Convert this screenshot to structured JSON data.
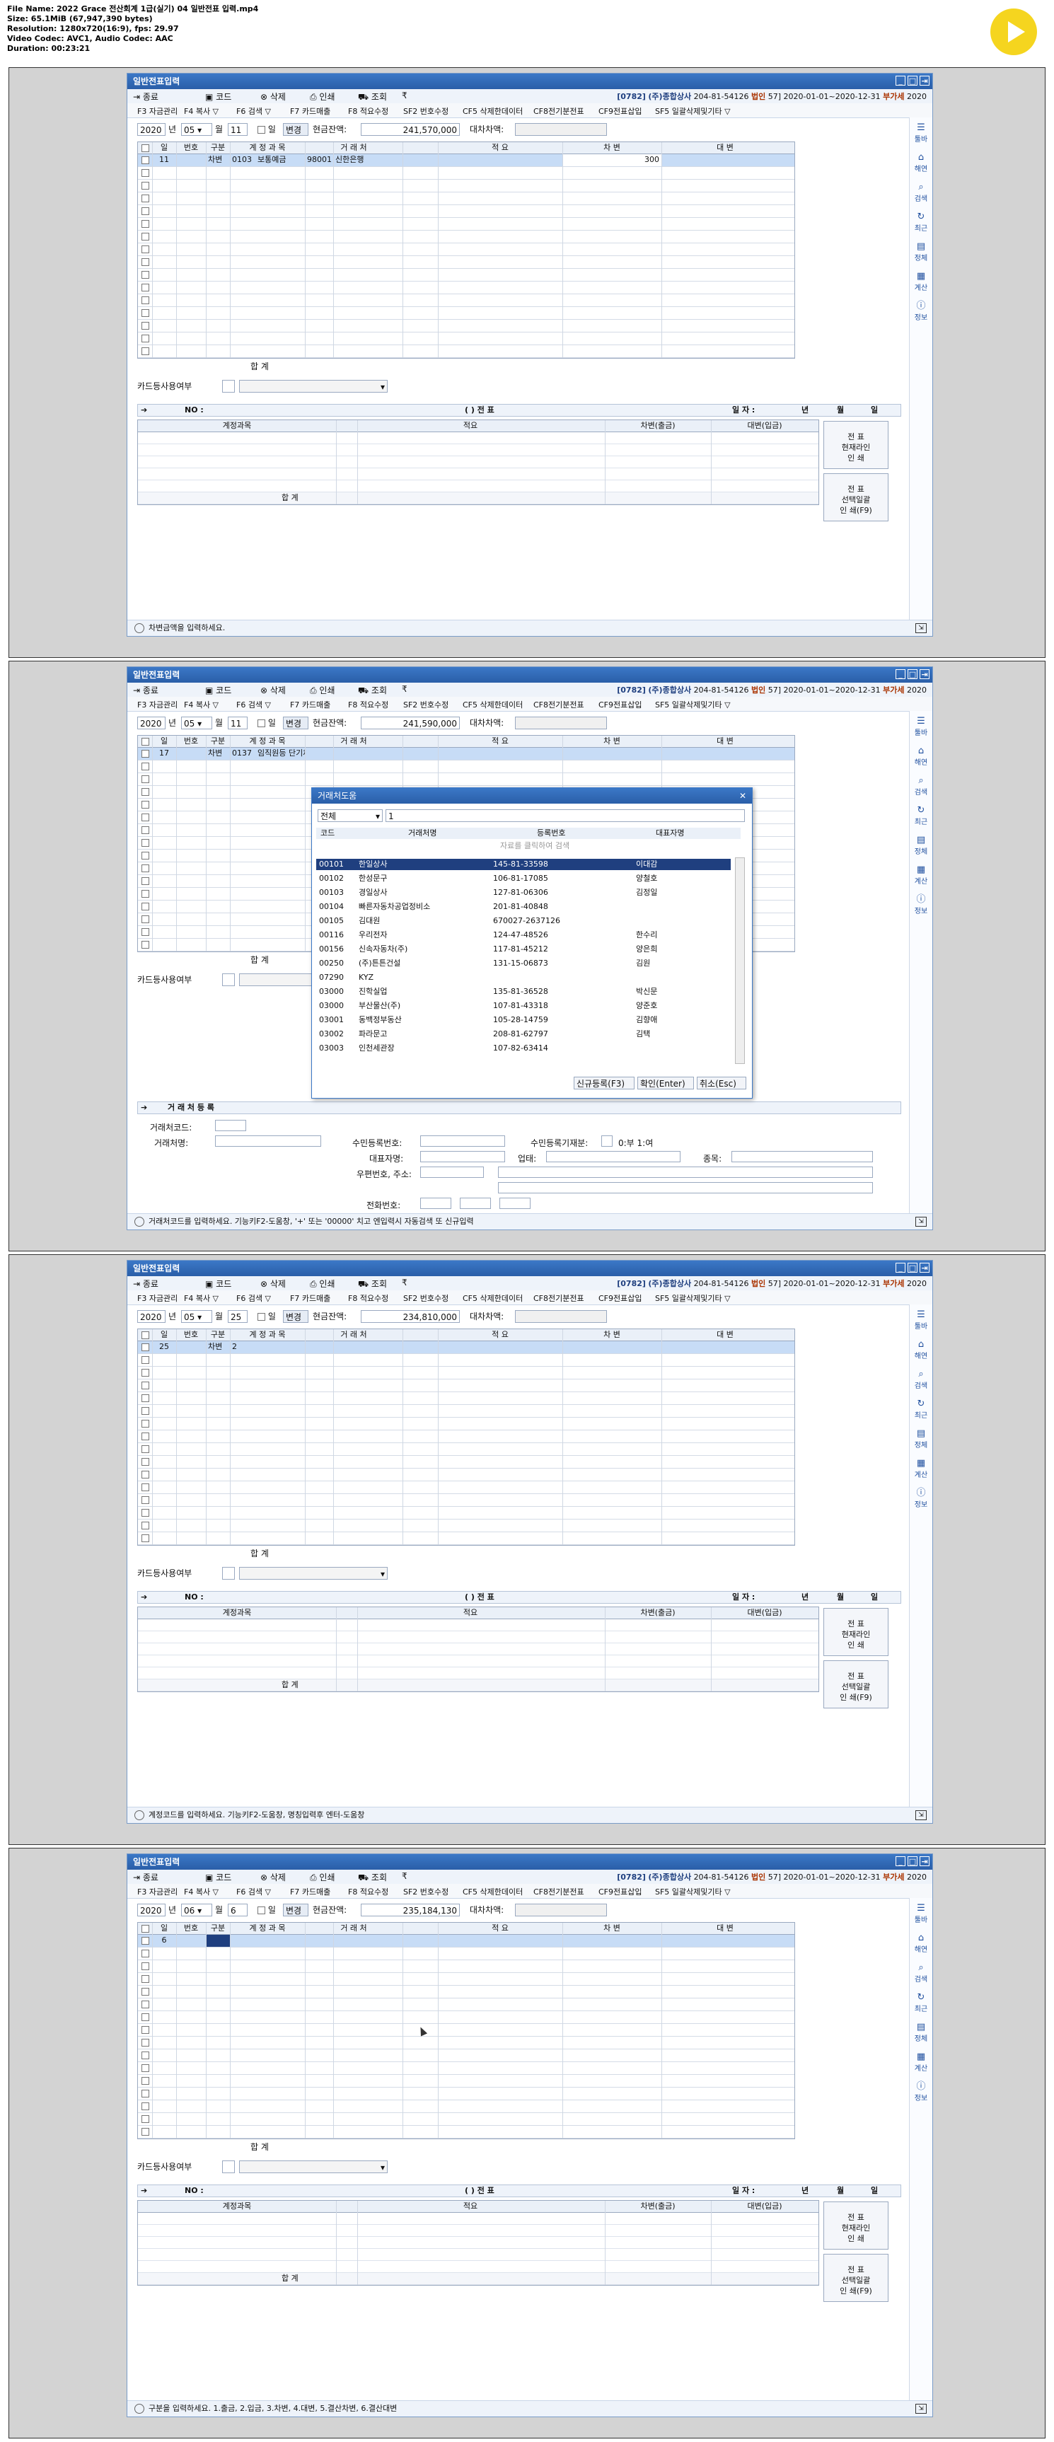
{
  "file_info": {
    "file_name": "File Name: 2022 Grace 전산회계 1급(실기) 04 일반전표 입력.mp4",
    "size": "Size: 65.1MiB (67,947,390 bytes)",
    "resolution": "Resolution: 1280x720(16:9), fps: 29.97",
    "video_codec": "Video Codec: AVC1, Audio Codec: AAC",
    "duration": "Duration: 00:23:21"
  },
  "window": {
    "title": "일반전표입력",
    "toolbar": {
      "close": "종료",
      "code": "코드",
      "delete": "삭제",
      "print": "인쇄",
      "view": "조회",
      "more": "₹"
    },
    "company_code": "[0782]",
    "company_name": "(주)종합상사",
    "biz_no": "204-81-54126",
    "entity": "법인",
    "period_no": "57]",
    "period": "2020-01-01~2020-12-31",
    "vat_label": "부가세",
    "vat_year": "2020",
    "fkeys": [
      "F3 자금관리",
      "F4 복사 ▽",
      "F6 검색 ▽",
      "F7 카드매출",
      "F8 적요수정",
      "SF2 번호수정",
      "CF5 삭제한데이터",
      "CF8전기분전표",
      "CF9전표삽입",
      "SF5 일괄삭제및기타 ▽"
    ],
    "sidebar": [
      "툴바",
      "해연",
      "검색",
      "최근",
      "정체",
      "계산",
      "정보"
    ],
    "labels": {
      "year": "년",
      "month": "월",
      "day": "일",
      "change": "변경",
      "cash_balance": "현금잔액:",
      "debit_credit_diff": "대차차액:",
      "total": "합      계",
      "card_usage": "카드등사용여부",
      "no": "NO :",
      "jeonpyo": "(          ) 전   표",
      "date": "일 자 :",
      "y": "년",
      "m": "월",
      "d": "일"
    },
    "grid_headers": {
      "day": "일",
      "no": "번호",
      "type": "구분",
      "account": "계 정 과 목",
      "client": "거 래 처",
      "memo": "적 요",
      "debit": "차 변",
      "credit": "대 변"
    },
    "journal_headers": {
      "account": "계정과목",
      "memo": "적요",
      "debit": "차변(출금)",
      "credit": "대변(입금)",
      "total": "합          계"
    },
    "journal_buttons": {
      "b1": [
        "전",
        "표",
        "현재라인",
        "인",
        "쇄"
      ],
      "b2": [
        "전",
        "표",
        "선택일괄",
        "인",
        "쇄(F9)"
      ]
    }
  },
  "frames": [
    {
      "year": "2020",
      "month": "05",
      "day": "11",
      "cash_balance": "241,570,000",
      "rows": [
        {
          "day": "11",
          "no": "",
          "type": "차변",
          "account_code": "0103",
          "account": "보통예금",
          "client_code": "98001",
          "client": "신한은행",
          "memo": "",
          "debit": "300",
          "credit": ""
        }
      ],
      "status": "차변금액을 입력하세요."
    },
    {
      "year": "2020",
      "month": "05",
      "day": "11",
      "cash_balance": "241,590,000",
      "rows": [
        {
          "day": "17",
          "no": "",
          "type": "차변",
          "account_code": "0137",
          "account": "임직원등 단기채권",
          "client_code": "",
          "client": "",
          "memo": "",
          "debit": "",
          "credit": ""
        }
      ],
      "status": "거래처코드를 입력하세요. 기능키F2-도움창, '+' 또는 '00000' 치고 엔입력시 자동검색 또 신규입력",
      "modal": {
        "title": "거래처도움",
        "filter": "전체",
        "search": "1",
        "headers": {
          "code": "코드",
          "name": "거래처명",
          "regno": "등록번호",
          "rep": "대표자명"
        },
        "hint": "자료를 클릭하여 검색",
        "rows": [
          {
            "code": "00101",
            "name": "한일상사",
            "regno": "145-81-33598",
            "rep": "이대감"
          },
          {
            "code": "00102",
            "name": "한성문구",
            "regno": "106-81-17085",
            "rep": "양철호"
          },
          {
            "code": "00103",
            "name": "경일상사",
            "regno": "127-81-06306",
            "rep": "김정일"
          },
          {
            "code": "00104",
            "name": "빠른자동차공업정비소",
            "regno": "201-81-40848",
            "rep": ""
          },
          {
            "code": "00105",
            "name": "김대원",
            "regno": "670027-2637126",
            "rep": ""
          },
          {
            "code": "00116",
            "name": "우리전자",
            "regno": "124-47-48526",
            "rep": "한수리"
          },
          {
            "code": "00156",
            "name": "신속자동차(주)",
            "regno": "117-81-45212",
            "rep": "양은희"
          },
          {
            "code": "00250",
            "name": "(주)튼튼건설",
            "regno": "131-15-06873",
            "rep": "김원"
          },
          {
            "code": "07290",
            "name": "KYZ",
            "regno": "",
            "rep": ""
          },
          {
            "code": "03000",
            "name": "진학실업",
            "regno": "135-81-36528",
            "rep": "박신문"
          },
          {
            "code": "03000",
            "name": "부산물산(주)",
            "regno": "107-81-43318",
            "rep": "양준호"
          },
          {
            "code": "03001",
            "name": "동백정부동산",
            "regno": "105-28-14759",
            "rep": "김향애"
          },
          {
            "code": "03002",
            "name": "파라문고",
            "regno": "208-81-62797",
            "rep": "김택"
          },
          {
            "code": "03003",
            "name": "인천세관장",
            "regno": "107-82-63414",
            "rep": ""
          }
        ],
        "buttons": {
          "new": "신규등록(F3)",
          "ok": "확인(Enter)",
          "cancel": "취소(Esc)"
        }
      },
      "reg": {
        "title": "거 래 처 등 록",
        "client_code": "거래처코드:",
        "client_name": "거래처명:",
        "reg_no": "수민등록번호:",
        "reg_type": "수민등록기재분:",
        "reg_type_val": "0:부 1:여",
        "rep": "대표자명:",
        "business": "업태:",
        "item": "종목:",
        "zip": "우편번호, 주소:",
        "phone": "전화번호:"
      }
    },
    {
      "year": "2020",
      "month": "05",
      "day": "25",
      "cash_balance": "234,810,000",
      "rows": [
        {
          "day": "25",
          "no": "",
          "type": "차변",
          "account_code": "2",
          "account": "",
          "client_code": "",
          "client": "",
          "memo": "",
          "debit": "",
          "credit": ""
        }
      ],
      "status": "계정코드를 입력하세요. 기능키F2-도움창, 명칭입력후 엔터-도움창"
    },
    {
      "year": "2020",
      "month": "06",
      "day": "6",
      "cash_balance": "235,184,130",
      "rows": [
        {
          "day": "6",
          "no": "",
          "type": "",
          "account_code": "",
          "account": "",
          "client_code": "",
          "client": "",
          "memo": "",
          "debit": "",
          "credit": ""
        }
      ],
      "status": "구분을 입력하세요. 1.출금, 2.입금, 3.차변, 4.대변, 5.결산차변, 6.결산대변"
    }
  ]
}
